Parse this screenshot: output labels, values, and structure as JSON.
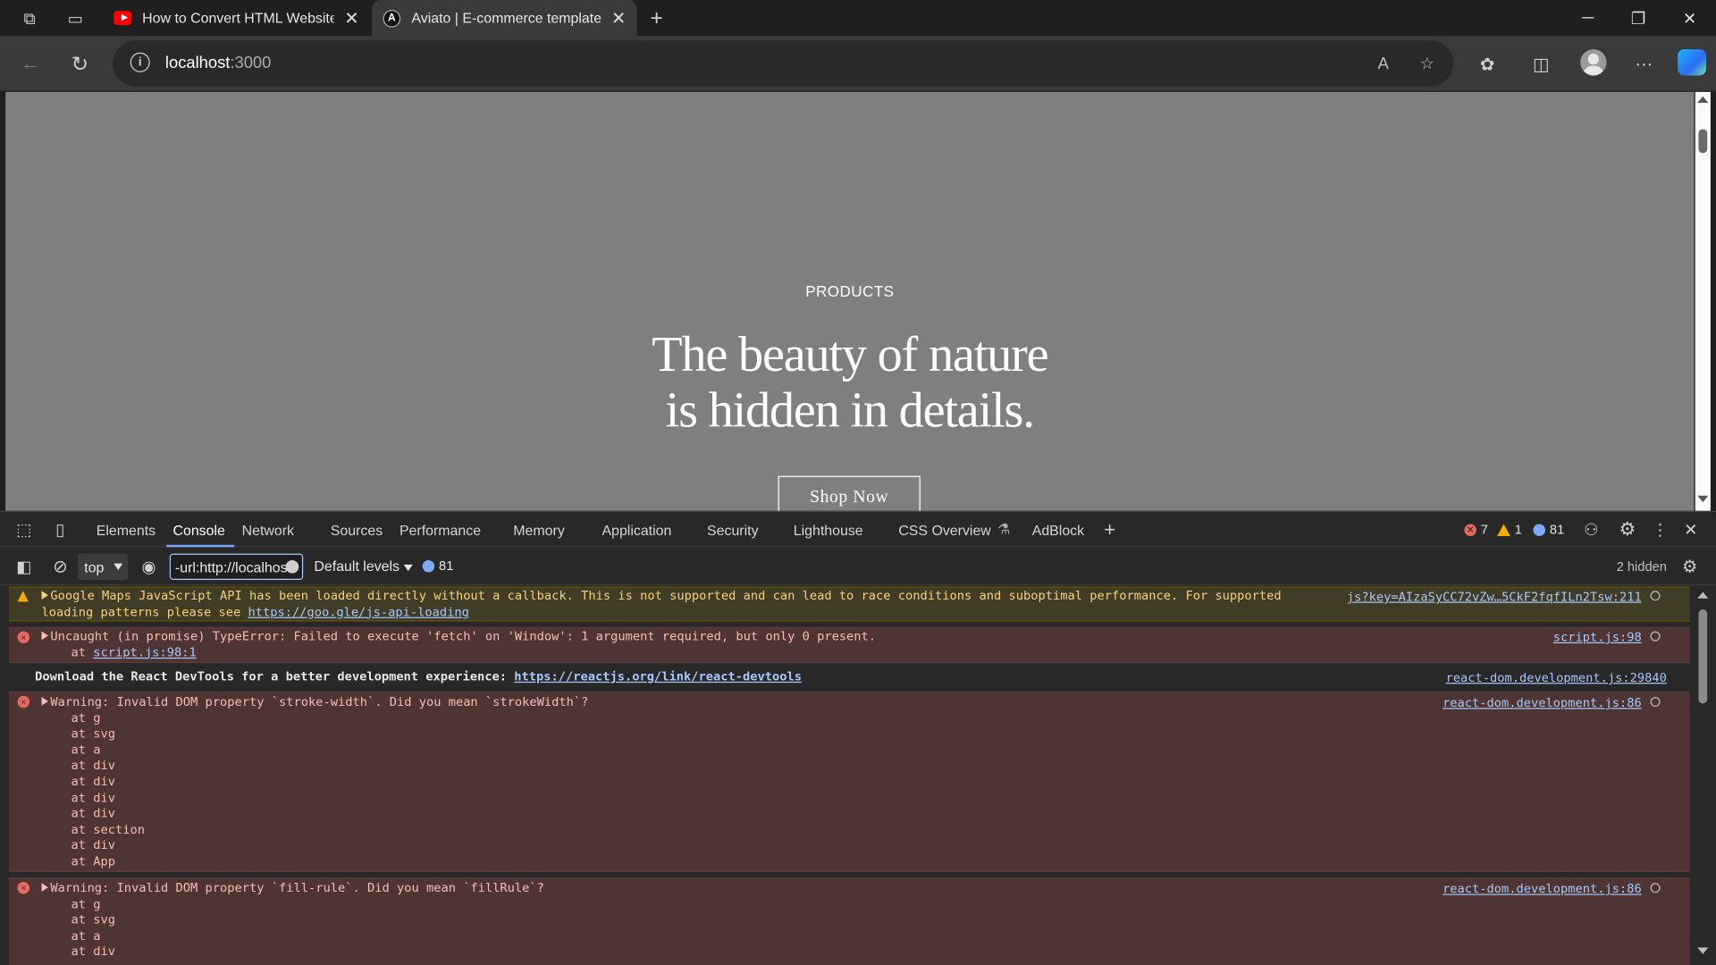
{
  "browser": {
    "tabs": [
      {
        "title": "How to Convert HTML Website to",
        "active": false,
        "favicon": "youtube-icon"
      },
      {
        "title": "Aviato | E-commerce template",
        "active": true,
        "favicon": "aviato-logo-icon",
        "favicon_letter": "A"
      }
    ],
    "address": {
      "host": "localhost",
      "port": ":3000"
    }
  },
  "page": {
    "eyebrow": "PRODUCTS",
    "title_line1": "The beauty of nature",
    "title_line2": "is hidden in details.",
    "cta": "Shop Now"
  },
  "devtools": {
    "tabs": [
      "Elements",
      "Console",
      "Network",
      "Sources",
      "Performance",
      "Memory",
      "Application",
      "Security",
      "Lighthouse",
      "CSS Overview",
      "AdBlock"
    ],
    "active_tab": "Console",
    "counts": {
      "errors": "7",
      "warnings": "1",
      "messages": "81"
    },
    "toolbar": {
      "context": "top",
      "filter_value": "-url:http://localhost",
      "levels": "Default levels",
      "message_count": "81",
      "hidden": "2 hidden"
    },
    "messages": [
      {
        "type": "warning",
        "lines": [
          "Google Maps JavaScript API has been loaded directly without a callback. This is not supported and can lead to race conditions and suboptimal performance. For supported",
          "loading patterns please see "
        ],
        "link": "https://goo.gle/js-api-loading",
        "source": "js?key=AIzaSyCC72vZw…5CkF2fqfILn2Tsw:211"
      },
      {
        "type": "error",
        "line1": "Uncaught (in promise) TypeError: Failed to execute 'fetch' on 'Window': 1 argument required, but only 0 present.",
        "at_prefix": "    at ",
        "at_link": "script.js:98:1",
        "source": "script.js:98"
      },
      {
        "type": "info",
        "text": "Download the React DevTools for a better development experience: ",
        "link": "https://reactjs.org/link/react-devtools",
        "source": "react-dom.development.js:29840"
      },
      {
        "type": "error",
        "line1": "Warning: Invalid DOM property `stroke-width`. Did you mean `strokeWidth`?",
        "stack": [
          "    at g",
          "    at svg",
          "    at a",
          "    at div",
          "    at div",
          "    at div",
          "    at div",
          "    at section",
          "    at div",
          "    at App"
        ],
        "source": "react-dom.development.js:86"
      },
      {
        "type": "error",
        "line1": "Warning: Invalid DOM property `fill-rule`. Did you mean `fillRule`?",
        "stack": [
          "    at g",
          "    at svg",
          "    at a",
          "    at div"
        ],
        "source": "react-dom.development.js:86"
      }
    ]
  }
}
